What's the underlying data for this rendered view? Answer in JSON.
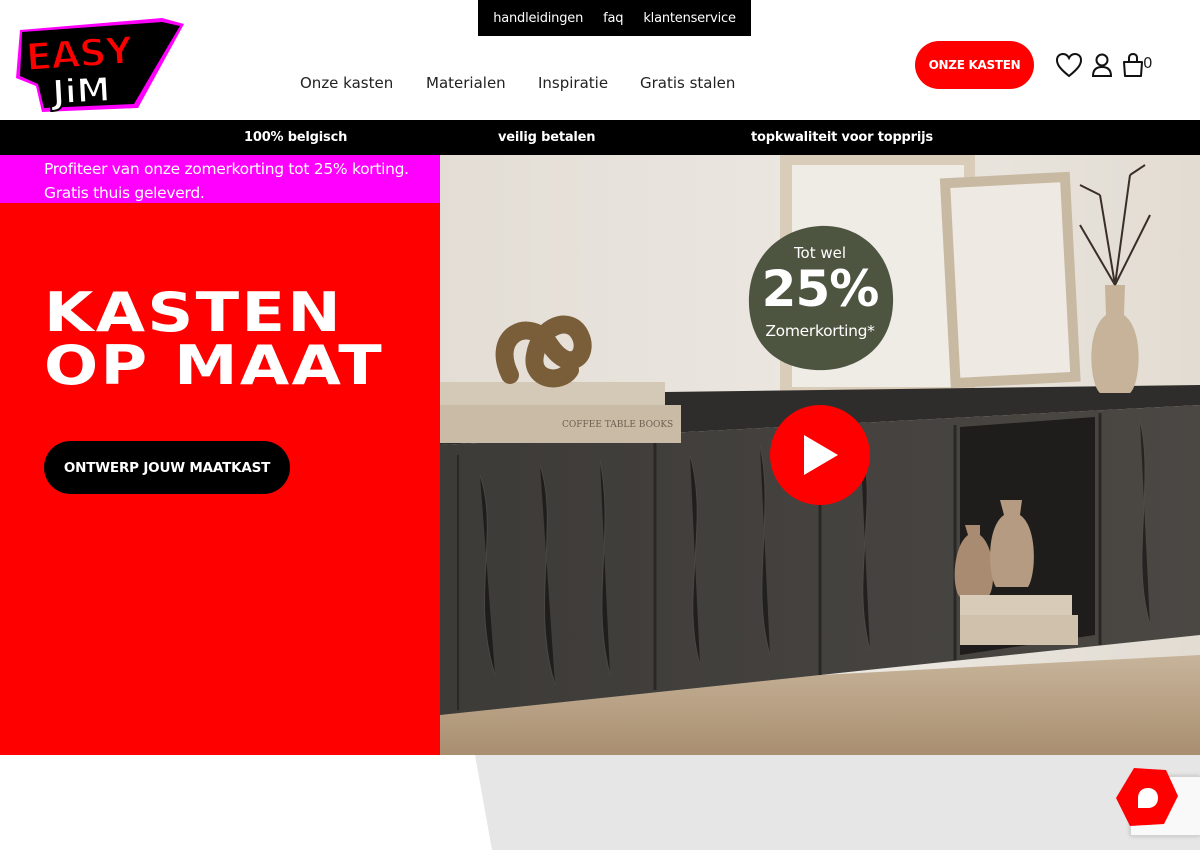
{
  "brand": {
    "logo_line1": "EASY",
    "logo_line2": "JiM",
    "colors": {
      "red": "#ff0000",
      "magenta": "#ff00ff",
      "black": "#000000"
    }
  },
  "topbar": {
    "links": [
      "handleidingen",
      "faq",
      "klantenservice"
    ]
  },
  "nav": {
    "items": [
      "Onze kasten",
      "Materialen",
      "Inspiratie",
      "Gratis stalen"
    ]
  },
  "header_actions": {
    "cta_label": "ONZE KASTEN",
    "icons": [
      "heart-icon",
      "user-icon",
      "cart-icon"
    ],
    "cart_count": "0"
  },
  "usp": [
    "100% belgisch",
    "veilig betalen",
    "topkwaliteit voor topprijs"
  ],
  "hero": {
    "promo_line1": "Profiteer van onze zomerkorting tot 25% korting.",
    "promo_line2": "Gratis thuis geleverd.",
    "title_line1": "KASTEN",
    "title_line2": "OP MAAT",
    "cta_label": "ONTWERP JOUW MAATKAST",
    "badge_top": "Tot wel",
    "badge_value": "25%",
    "badge_bottom": "Zomerkorting*",
    "book_spine_1": "COFFEE TABLE BOOKS"
  }
}
